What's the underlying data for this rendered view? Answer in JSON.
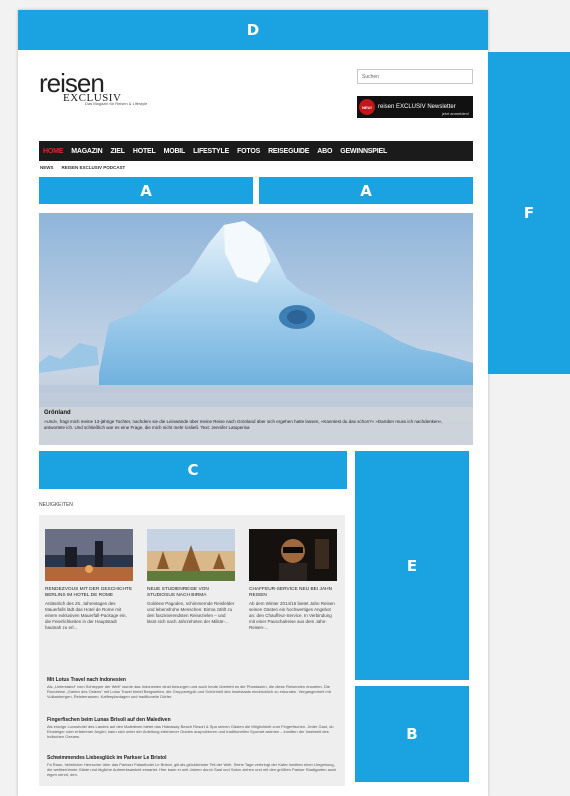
{
  "ads": {
    "d": "D",
    "f": "F",
    "a1": "A",
    "a2": "A",
    "c": "C",
    "e": "E",
    "b": "B"
  },
  "header": {
    "logo_main": "reisen",
    "logo_sub": "EXCLUSIV",
    "tagline": "Das Magazin für Reisen & Lifestyle",
    "search_placeholder": "Suchen",
    "newsletter_badge": "NEU!",
    "newsletter_label": "reisen EXCLUSIV Newsletter",
    "newsletter_sub": "jetzt anmelden!"
  },
  "nav": {
    "items": [
      "HOME",
      "MAGAZIN",
      "ZIEL",
      "HOTEL",
      "MOBIL",
      "LIFESTYLE",
      "FOTOS",
      "REISEGUIDE",
      "ABO",
      "GEWINNSPIEL"
    ],
    "sub_items": [
      "NEWS",
      "REISEN EXCLUSIV PODCAST"
    ]
  },
  "hero": {
    "title": "Grönland",
    "text": "»Und«, fragt mich meine 13-jährige Tochter, nachdem sie die Leinwände über meine Reise nach Grönland über sich ergehen hatte lassen, »Kanntest du das schon?« »Darüber muss ich nachdenken«, antwortete ich. Und schließlich war es eine Frage, die mich nicht mehr losließ. Text: Jennifer Latuperisa"
  },
  "news": {
    "section_title": "NEUIGKEITEN",
    "cards": [
      {
        "title": "RENDEZVOUS MIT DER GESCHICHTE BERLINS IM HOTEL DE ROME",
        "text": "Anlässlich des 25. Jahrestages des Mauerfalls lädt das Hotel de Rome mit einem exklusiven Mauerfall-Package ein, die Feierlichkeiten in der Hauptstadt hautnah zu erl..."
      },
      {
        "title": "NEUE STUDIENREISE VON STUDIOSUS NACH BIRMA",
        "text": "Goldene Pagoden, schimmernde Reisfelder und lebensfrohe Menschen: Birma zählt zu den faszinierendsten Reisezielen – und lässt sich nach Jahrzehnten der Militär-..."
      },
      {
        "title": "CHAFFEUR-SERVICE NEU BEI JAHN REISEN",
        "text": "Ab dem Winter 2014/15 bietet Jahn Reisen seinen Gästen ein hochwertiges Angebot an: den Chauffeur-Service. In Verbindung mit einer Pauschalreise aus dem Jahn-Reisen-..."
      }
    ],
    "articles": [
      {
        "title": "Mit Lotus Travel nach Indonesien",
        "text": "Als „Unterstand“ vom Schlepper der Welt“ wurde das Indonesien einst besungen und auch heute überlebt es die Phantasien, die diese Reisenden erwarten. Die Rundreise „Garten des Ostens“ mit Lotus Travel bietet Bergwelten, die Gruppentypik und Schönheit des Inselstaats eindrücklich zu erkunden. Vergangenheit mit Vulkanbergen, Reisterrassen, Kaffeeplantagen und traditionelle Dörfer."
      },
      {
        "title": "Fingerfischen beim Lunas Brisoli auf den Malediven",
        "text": "Als einzige Luxushotel des Landes auf den Malediven bietet das Hideaway Beach Resort & Spa seinen Gästen die Möglichkeit zum Fingerfischen. Jeder Gast, ob Einsteiger oder erfahrener Angler, kann sich unter der Anleitung erfahrener Guides ausprobieren und traditionellen Sportart widmen – inmitten der Inselwelt des Indischen Ozeans."
      },
      {
        "title": "Schwimmendes Liebesglück im Parkser Le Bristol",
        "text": "Fa Raon, heimlicher Herrscher über das Parkser Palasthotel Le Bristol, gilt als glücklichster Teil der Welt. Seine Tage verbringt der Kater inmitten einer Umgebung, die weltberühmte Gäste und tägliche Aufmerksamkeit erwartet. Hier kann er seit Jahren durch Saal und Salon ziehen und mit den größten Pariser Stadtgarten auch eigen nennt, den."
      }
    ]
  }
}
